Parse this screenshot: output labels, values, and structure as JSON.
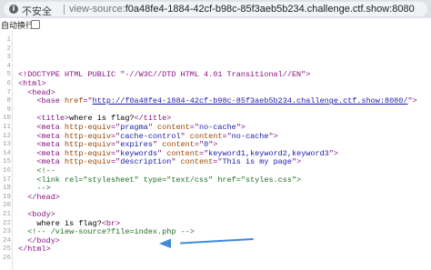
{
  "address_bar": {
    "security_label": "不安全",
    "scheme": "view-source:",
    "url": "f0a48fe4-1884-42cf-b98c-85f3aeb5b234.challenge.ctf.show:8080"
  },
  "line_wrap": {
    "label": "自动换行",
    "checked": false
  },
  "source_lines": [
    {
      "n": "1",
      "html": ""
    },
    {
      "n": "2",
      "html": ""
    },
    {
      "n": "3",
      "html": ""
    },
    {
      "n": "4",
      "html": ""
    },
    {
      "n": "5",
      "html": "<span class=\"t\">&lt;!DOCTYPE HTML PUBLIC \"-//W3C//DTD HTML 4.01 Transitional//EN\"&gt;</span>"
    },
    {
      "n": "6",
      "html": "<span class=\"t\">&lt;html&gt;</span>"
    },
    {
      "n": "7",
      "html": "  <span class=\"t\">&lt;head&gt;</span>"
    },
    {
      "n": "8",
      "html": "    <span class=\"t\">&lt;base </span><span class=\"a\">href</span><span class=\"t\">=\"</span><span class=\"lnk\">http://f0a48fe4-1884-42cf-b98c-85f3aeb5b234.challenge.ctf.show:8080/</span><span class=\"t\">\"&gt;</span>"
    },
    {
      "n": "9",
      "html": ""
    },
    {
      "n": "10",
      "html": "    <span class=\"t\">&lt;title&gt;</span><span class=\"txt\">where is flag?</span><span class=\"t\">&lt;/title&gt;</span>"
    },
    {
      "n": "11",
      "html": "    <span class=\"t\">&lt;meta </span><span class=\"a\">http-equiv</span><span class=\"t\">=\"</span><span class=\"v\">pragma</span><span class=\"t\">\" </span><span class=\"a\">content</span><span class=\"t\">=\"</span><span class=\"v\">no-cache</span><span class=\"t\">\"&gt;</span>"
    },
    {
      "n": "12",
      "html": "    <span class=\"t\">&lt;meta </span><span class=\"a\">http-equiv</span><span class=\"t\">=\"</span><span class=\"v\">cache-control</span><span class=\"t\">\" </span><span class=\"a\">content</span><span class=\"t\">=\"</span><span class=\"v\">no-cache</span><span class=\"t\">\"&gt;</span>"
    },
    {
      "n": "13",
      "html": "    <span class=\"t\">&lt;meta </span><span class=\"a\">http-equiv</span><span class=\"t\">=\"</span><span class=\"v\">expires</span><span class=\"t\">\" </span><span class=\"a\">content</span><span class=\"t\">=\"</span><span class=\"v\">0</span><span class=\"t\">\"&gt;</span>"
    },
    {
      "n": "14",
      "html": "    <span class=\"t\">&lt;meta </span><span class=\"a\">http-equiv</span><span class=\"t\">=\"</span><span class=\"v\">keywords</span><span class=\"t\">\" </span><span class=\"a\">content</span><span class=\"t\">=\"</span><span class=\"v\">keyword1,keyword2,keyword3</span><span class=\"t\">\"&gt;</span>"
    },
    {
      "n": "15",
      "html": "    <span class=\"t\">&lt;meta </span><span class=\"a\">http-equiv</span><span class=\"t\">=\"</span><span class=\"v\">description</span><span class=\"t\">\" </span><span class=\"a\">content</span><span class=\"t\">=\"</span><span class=\"v\">This is my page</span><span class=\"t\">\"&gt;</span>"
    },
    {
      "n": "16",
      "html": "    <span class=\"c\">&lt;!--</span>"
    },
    {
      "n": "17",
      "html": "<span class=\"c\">    &lt;link rel=\"stylesheet\" type=\"text/css\" href=\"styles.css\"&gt;</span>"
    },
    {
      "n": "18",
      "html": "<span class=\"c\">    --&gt;</span>"
    },
    {
      "n": "19",
      "html": "  <span class=\"t\">&lt;/head&gt;</span>"
    },
    {
      "n": "20",
      "html": ""
    },
    {
      "n": "21",
      "html": "  <span class=\"t\">&lt;body&gt;</span>"
    },
    {
      "n": "22",
      "html": "    <span class=\"txt\">where is flag?</span><span class=\"t\">&lt;br&gt;</span>"
    },
    {
      "n": "23",
      "html": "  <span class=\"c\">&lt;!-- /view-source?file=index.php --&gt;</span>"
    },
    {
      "n": "24",
      "html": "  <span class=\"t\">&lt;/body&gt;</span>"
    },
    {
      "n": "25",
      "html": "<span class=\"t\">&lt;/html&gt;</span>"
    },
    {
      "n": "26",
      "html": ""
    }
  ],
  "colors": {
    "annotation_arrow": "#3d8bd9"
  },
  "icons": {
    "security": "info-circle-icon",
    "annotation": "arrow-left-icon"
  }
}
